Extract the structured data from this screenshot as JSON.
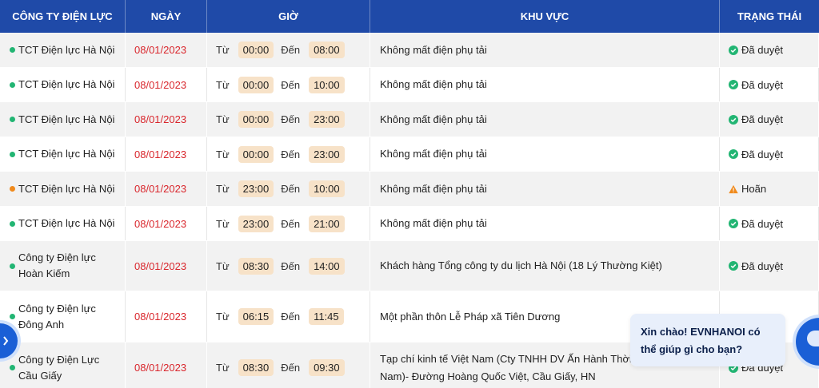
{
  "headers": {
    "company": "CÔNG TY ĐIỆN LỰC",
    "date": "NGÀY",
    "time": "GIỜ",
    "area": "KHU VỰC",
    "status": "TRẠNG THÁI"
  },
  "labels": {
    "from": "Từ",
    "to": "Đến"
  },
  "rows": [
    {
      "company": "TCT Điện lực Hà Nội",
      "date": "08/01/2023",
      "start": "00:00",
      "end": "08:00",
      "area": "Không mất điện phụ tải",
      "status": "Đã duyệt",
      "status_type": "approved"
    },
    {
      "company": "TCT Điện lực Hà Nội",
      "date": "08/01/2023",
      "start": "00:00",
      "end": "10:00",
      "area": "Không mất điện phụ tải",
      "status": "Đã duyệt",
      "status_type": "approved"
    },
    {
      "company": "TCT Điện lực Hà Nội",
      "date": "08/01/2023",
      "start": "00:00",
      "end": "23:00",
      "area": "Không mất điện phụ tải",
      "status": "Đã duyệt",
      "status_type": "approved"
    },
    {
      "company": "TCT Điện lực Hà Nội",
      "date": "08/01/2023",
      "start": "00:00",
      "end": "23:00",
      "area": "Không mất điện phụ tải",
      "status": "Đã duyệt",
      "status_type": "approved"
    },
    {
      "company": "TCT Điện lực Hà Nội",
      "date": "08/01/2023",
      "start": "23:00",
      "end": "10:00",
      "area": "Không mất điện phụ tải",
      "status": "Hoãn",
      "status_type": "postponed"
    },
    {
      "company": "TCT Điện lực Hà Nội",
      "date": "08/01/2023",
      "start": "23:00",
      "end": "21:00",
      "area": "Không mất điện phụ tải",
      "status": "Đã duyệt",
      "status_type": "approved"
    },
    {
      "company_lines": [
        "Công ty Điện lực",
        "Hoàn Kiếm"
      ],
      "date": "08/01/2023",
      "start": "08:30",
      "end": "14:00",
      "area": "Khách hàng Tổng công ty du lịch Hà Nội (18 Lý Thường Kiệt)",
      "status": "Đã duyệt",
      "status_type": "approved"
    },
    {
      "company_lines": [
        "Công ty Điện lực",
        "Đông Anh"
      ],
      "date": "08/01/2023",
      "start": "06:15",
      "end": "11:45",
      "area": "Một phần thôn Lễ Pháp xã Tiên Dương",
      "status": "",
      "status_type": "hidden"
    },
    {
      "company_lines": [
        "Công ty Điện Lực",
        "Cầu Giấy"
      ],
      "date": "08/01/2023",
      "start": "08:30",
      "end": "09:30",
      "area_lines": [
        "Tạp chí kinh tế Việt Nam (Cty TNHH DV Ấn Hành Thời b",
        "Nam)- Đường Hoàng Quốc Việt, Cầu Giấy, HN"
      ],
      "status": "Đã duyệt",
      "status_type": "approved"
    }
  ],
  "chat": {
    "line1": "Xin chào! EVNHANOI có",
    "line2": "thể giúp gì cho bạn?"
  },
  "colors": {
    "header": "#1f4aa8",
    "approved": "#22b573",
    "postponed": "#f08a1c",
    "date": "#d9262c",
    "pill": "#f7e2c8"
  }
}
